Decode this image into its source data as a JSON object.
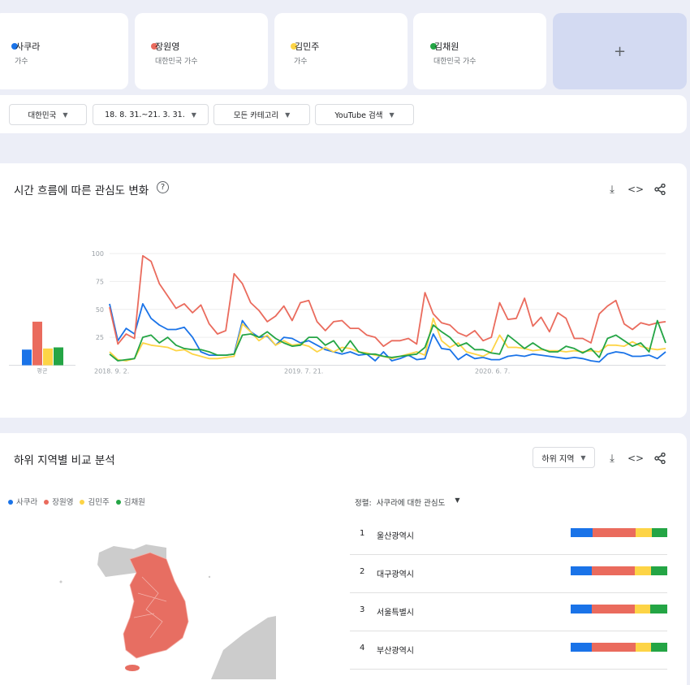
{
  "colors": {
    "blue": "#1a73e8",
    "red": "#ea6b5d",
    "yellow": "#fdd446",
    "green": "#24a545"
  },
  "terms": [
    {
      "name": "사쿠라",
      "sub": "가수",
      "color": "#1a73e8"
    },
    {
      "name": "장원영",
      "sub": "대한민국 가수",
      "color": "#ea6b5d"
    },
    {
      "name": "김민주",
      "sub": "가수",
      "color": "#fdd446"
    },
    {
      "name": "김채원",
      "sub": "대한민국 가수",
      "color": "#24a545"
    }
  ],
  "add_label": "+",
  "filters": [
    "대한민국",
    "18. 8. 31.~21. 3. 31.",
    "모든 카테고리",
    "YouTube 검색"
  ],
  "timeline": {
    "title": "시간 흐름에 따른 관심도 변화",
    "help_icon": "?",
    "icons": [
      "download-icon",
      "embed-icon",
      "share-icon"
    ]
  },
  "chart_data": {
    "type": "line",
    "yticks": [
      100,
      75,
      50,
      25
    ],
    "ylim": [
      0,
      100
    ],
    "xtick_labels": [
      "2018. 9. 2.",
      "2019. 7. 21.",
      "2020. 6. 7."
    ],
    "grid": true,
    "average_label": "평균",
    "averages": [
      14,
      39,
      15,
      16
    ],
    "series": [
      {
        "name": "사쿠라",
        "color": "#1a73e8",
        "values": [
          55,
          22,
          33,
          28,
          55,
          42,
          36,
          32,
          32,
          34,
          25,
          12,
          9,
          9,
          9,
          10,
          40,
          30,
          25,
          26,
          18,
          25,
          24,
          20,
          22,
          18,
          14,
          12,
          10,
          12,
          9,
          10,
          4,
          12,
          4,
          6,
          9,
          5,
          6,
          28,
          15,
          14,
          5,
          10,
          6,
          7,
          5,
          5,
          8,
          9,
          8,
          10,
          9,
          8,
          7,
          6,
          7,
          6,
          4,
          3,
          10,
          12,
          11,
          8,
          8,
          9,
          6,
          12
        ]
      },
      {
        "name": "장원영",
        "color": "#ea6b5d",
        "values": [
          52,
          19,
          28,
          24,
          98,
          93,
          73,
          62,
          51,
          55,
          47,
          54,
          37,
          28,
          31,
          82,
          73,
          56,
          49,
          39,
          44,
          53,
          40,
          56,
          58,
          39,
          31,
          39,
          40,
          33,
          33,
          27,
          25,
          17,
          22,
          22,
          24,
          19,
          65,
          46,
          38,
          36,
          29,
          26,
          31,
          22,
          25,
          56,
          41,
          42,
          60,
          35,
          43,
          30,
          47,
          42,
          24,
          24,
          20,
          46,
          53,
          58,
          37,
          32,
          38,
          36,
          38,
          39
        ]
      },
      {
        "name": "김민주",
        "color": "#fdd446",
        "values": [
          12,
          5,
          4,
          6,
          20,
          18,
          17,
          16,
          13,
          14,
          10,
          8,
          6,
          6,
          7,
          8,
          37,
          30,
          22,
          27,
          18,
          22,
          18,
          19,
          17,
          12,
          16,
          12,
          16,
          15,
          12,
          11,
          9,
          8,
          6,
          8,
          10,
          12,
          9,
          42,
          22,
          16,
          20,
          12,
          10,
          8,
          12,
          27,
          16,
          16,
          15,
          13,
          14,
          13,
          13,
          12,
          13,
          12,
          13,
          12,
          18,
          18,
          17,
          21,
          17,
          15,
          14,
          15
        ]
      },
      {
        "name": "김채원",
        "color": "#24a545",
        "values": [
          10,
          4,
          5,
          6,
          25,
          27,
          20,
          25,
          18,
          15,
          14,
          14,
          12,
          9,
          9,
          10,
          27,
          28,
          25,
          30,
          24,
          20,
          17,
          18,
          25,
          25,
          18,
          22,
          12,
          22,
          12,
          10,
          10,
          8,
          7,
          8,
          9,
          10,
          16,
          36,
          30,
          25,
          17,
          20,
          14,
          14,
          11,
          10,
          27,
          21,
          15,
          20,
          15,
          12,
          12,
          17,
          15,
          11,
          15,
          7,
          24,
          27,
          22,
          17,
          20,
          12,
          40,
          20
        ]
      }
    ]
  },
  "regions": {
    "title": "하위 지역별 비교 분석",
    "dropdown": "하위 지역",
    "legend": [
      "사쿠라",
      "장원영",
      "김민주",
      "김채원"
    ],
    "sort_label": "정렬:",
    "sort_value": "사쿠라에 대한 관심도",
    "rows": [
      {
        "rank": "1",
        "name": "울산광역시",
        "shares": [
          23,
          44,
          17,
          16
        ]
      },
      {
        "rank": "2",
        "name": "대구광역시",
        "shares": [
          22,
          44,
          17,
          17
        ]
      },
      {
        "rank": "3",
        "name": "서울특별시",
        "shares": [
          22,
          44,
          16,
          18
        ]
      },
      {
        "rank": "4",
        "name": "부산광역시",
        "shares": [
          22,
          45,
          16,
          17
        ]
      }
    ]
  }
}
